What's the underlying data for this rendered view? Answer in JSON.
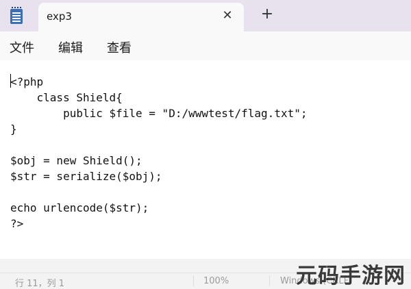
{
  "tab": {
    "title": "exp3",
    "close_glyph": "✕",
    "new_tab_glyph": "+"
  },
  "menu": {
    "file": "文件",
    "edit": "编辑",
    "view": "查看"
  },
  "editor": {
    "lines": [
      "<?php",
      "    class Shield{",
      "        public $file = \"D:/wwwtest/flag.txt\";",
      "}",
      "",
      "$obj = new Shield();",
      "$str = serialize($obj);",
      "",
      "echo urlencode($str);",
      "?>"
    ]
  },
  "status": {
    "position": "行 11，列 1",
    "zoom": "100%",
    "line_ending": "Windows (CRLF)"
  },
  "watermark": "元码手游网",
  "icons": {
    "app": "notepad-icon",
    "close": "close-icon",
    "add": "plus-icon"
  }
}
